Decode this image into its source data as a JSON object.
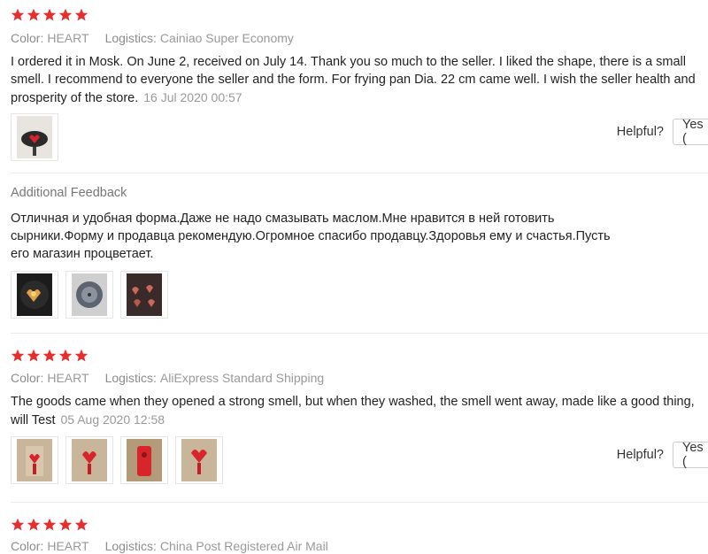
{
  "colors": {
    "star": "#e62e2e",
    "muted": "#999999",
    "text": "#222222"
  },
  "reviews": [
    {
      "rating": 5,
      "color_label": "Color:",
      "color_value": "HEART",
      "logistics_label": "Logistics:",
      "logistics_value": "Cainiao Super Economy",
      "text": "I ordered it in Mosk. On June 2, received on July 14. Thank you so much to the seller. I liked the shape, there is a small smell. I recommend to everyone the seller and the form. For frying pan Dia. 22 cm came well. I wish the seller health and prosperity of the store.",
      "date": "16 Jul 2020 00:57",
      "photos": [
        "photo-pan-red"
      ],
      "helpful_label": "Helpful?",
      "yes_label": "Yes ("
    },
    {
      "rating": 5,
      "color_label": "Color:",
      "color_value": "HEART",
      "logistics_label": "Logistics:",
      "logistics_value": "AliExpress Standard Shipping",
      "text": "The goods came when they opened a strong smell, but when they washed, the smell went away, made like a good thing, will Test",
      "date": "05 Aug 2020 12:58",
      "photos": [
        "photo-mold-1",
        "photo-mold-2",
        "photo-mold-3",
        "photo-mold-4"
      ],
      "helpful_label": "Helpful?",
      "yes_label": "Yes ("
    },
    {
      "rating": 5,
      "color_label": "Color:",
      "color_value": "HEART",
      "logistics_label": "Logistics:",
      "logistics_value": "China Post Registered Air Mail"
    }
  ],
  "additional_feedback": {
    "title": "Additional Feedback",
    "text": "Отличная и удобная форма.Даже не надо смазывать маслом.Мне нравится в ней готовить сырники.Форму и продавца рекомендую.Огромное спасибо продавцу.Здоровья ему и счастья.Пусть его магазин процветает.",
    "photos": [
      "photo-pan-eggs",
      "photo-pan-lid",
      "photo-pan-cakes"
    ]
  }
}
